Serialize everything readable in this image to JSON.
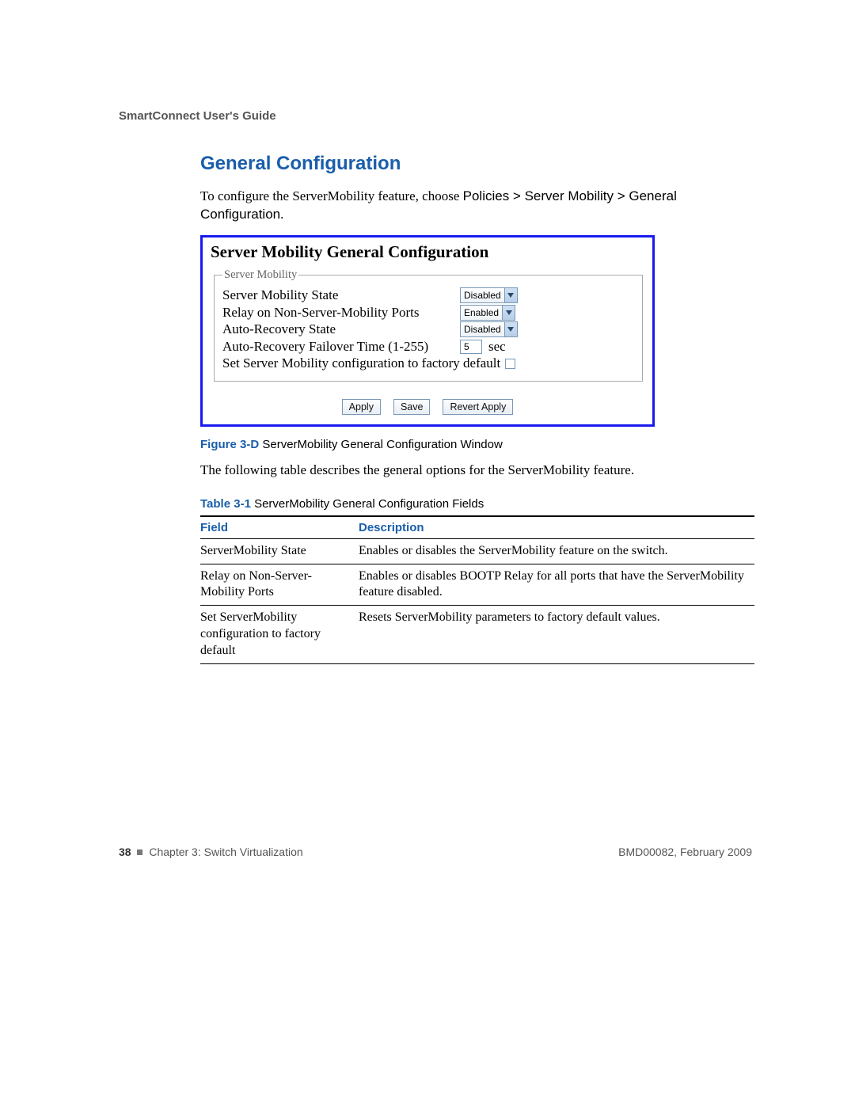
{
  "running_head": "SmartConnect User's Guide",
  "section_title": "General Configuration",
  "intro_prefix": "To configure the ServerMobility feature, choose ",
  "intro_path": "Policies > Server Mobility > General Configuration",
  "intro_suffix": ".",
  "figure": {
    "panel_title": "Server Mobility General Configuration",
    "legend": "Server Mobility",
    "rows": {
      "state_label": "Server Mobility State",
      "state_value": "Disabled",
      "relay_label": "Relay on Non-Server-Mobility Ports",
      "relay_value": "Enabled",
      "autorec_label": "Auto-Recovery State",
      "autorec_value": "Disabled",
      "failover_label": "Auto-Recovery Failover Time (1-255)",
      "failover_value": "5",
      "failover_unit": "sec",
      "factory_label": "Set Server Mobility configuration to factory default"
    },
    "buttons": {
      "apply": "Apply",
      "save": "Save",
      "revert": "Revert Apply"
    }
  },
  "figure_caption": {
    "lead": "Figure 3-D",
    "text": "  ServerMobility General Configuration Window"
  },
  "after_figure": "The following table describes the general options for the ServerMobility feature.",
  "table_caption": {
    "lead": "Table 3-1",
    "text": "  ServerMobility General Configuration Fields"
  },
  "table": {
    "head_field": "Field",
    "head_desc": "Description",
    "rows": [
      {
        "field": "ServerMobility State",
        "desc": "Enables or disables the ServerMobility feature on the switch."
      },
      {
        "field": "Relay on Non-Server-Mobility Ports",
        "desc": "Enables or disables BOOTP Relay for all ports that have the ServerMobility feature disabled."
      },
      {
        "field": "Set ServerMobility configuration to factory default",
        "desc": "Resets ServerMobility parameters to factory default values."
      }
    ]
  },
  "footer": {
    "page_no": "38",
    "chapter": "Chapter 3: Switch Virtualization",
    "docid": "BMD00082, February 2009"
  }
}
